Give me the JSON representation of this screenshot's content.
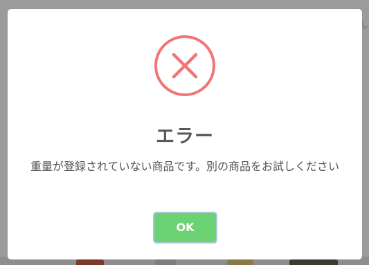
{
  "background": {
    "partial_text": "ん"
  },
  "modal": {
    "icon": "error-x-icon",
    "icon_color": "#f27474",
    "title": "エラー",
    "message": "重量が登録されていない商品です。別の商品をお試しください",
    "ok_label": "OK",
    "ok_color": "#6cd273"
  }
}
